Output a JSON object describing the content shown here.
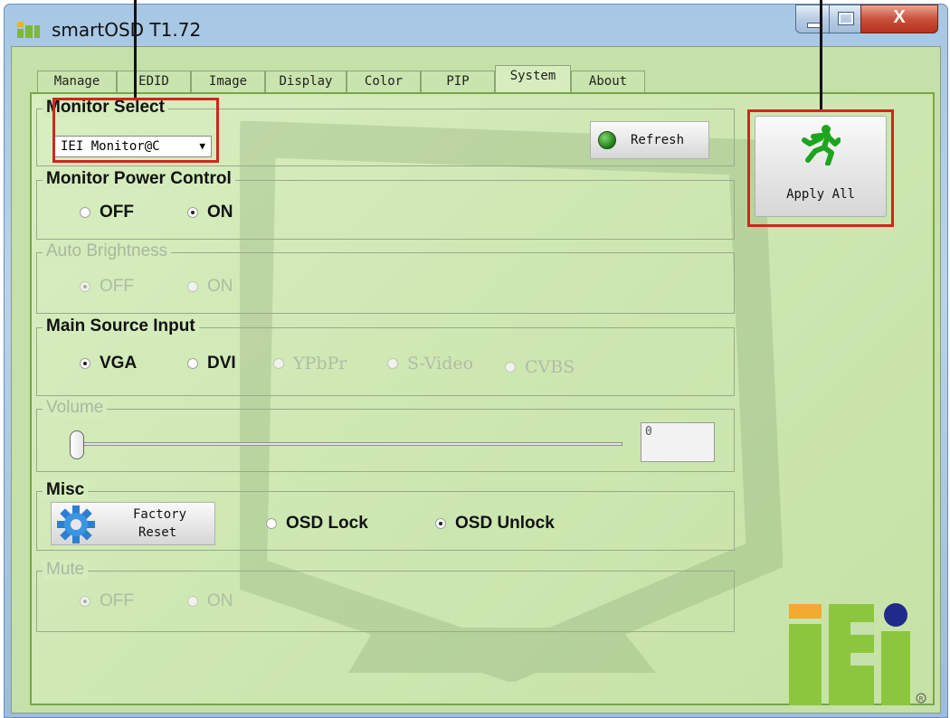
{
  "window": {
    "title": "smartOSD T1.72",
    "close_glyph": "X"
  },
  "tabs": [
    {
      "label": "Manage",
      "active": false
    },
    {
      "label": "EDID",
      "active": false
    },
    {
      "label": "Image",
      "active": false
    },
    {
      "label": "Display",
      "active": false
    },
    {
      "label": "Color",
      "active": false
    },
    {
      "label": "PIP",
      "active": false
    },
    {
      "label": "System",
      "active": true
    },
    {
      "label": "About",
      "active": false
    }
  ],
  "monitor_select": {
    "legend": "Monitor Select",
    "value": "IEI Monitor@C",
    "refresh_label": "Refresh"
  },
  "apply_all": {
    "label": "Apply All",
    "icon": "running-man-icon"
  },
  "power": {
    "legend": "Monitor Power Control",
    "options": [
      "OFF",
      "ON"
    ],
    "selected": "ON"
  },
  "auto_brightness": {
    "legend": "Auto Brightness",
    "options": [
      "OFF",
      "ON"
    ],
    "selected": "OFF",
    "enabled": false
  },
  "source": {
    "legend": "Main Source Input",
    "options": [
      "VGA",
      "DVI",
      "YPbPr",
      "S-Video",
      "CVBS"
    ],
    "selected": "VGA",
    "disabled": [
      "YPbPr",
      "S-Video",
      "CVBS"
    ]
  },
  "volume": {
    "legend": "Volume",
    "value": "0",
    "level": 0,
    "enabled": false
  },
  "misc": {
    "legend": "Misc",
    "factory_reset_line1": "Factory",
    "factory_reset_line2": "Reset",
    "osd_options": [
      "OSD Lock",
      "OSD Unlock"
    ],
    "selected": "OSD Unlock"
  },
  "mute": {
    "legend": "Mute",
    "options": [
      "OFF",
      "ON"
    ],
    "selected": "OFF",
    "enabled": false
  },
  "logo": {
    "text": "iEi",
    "registered": "®"
  },
  "colors": {
    "highlight": "#d0261d",
    "panel_bg": "#d4ecbb",
    "logo_green": "#8cc63f",
    "logo_orange": "#f2a92f",
    "logo_blue": "#1f2a8a"
  }
}
